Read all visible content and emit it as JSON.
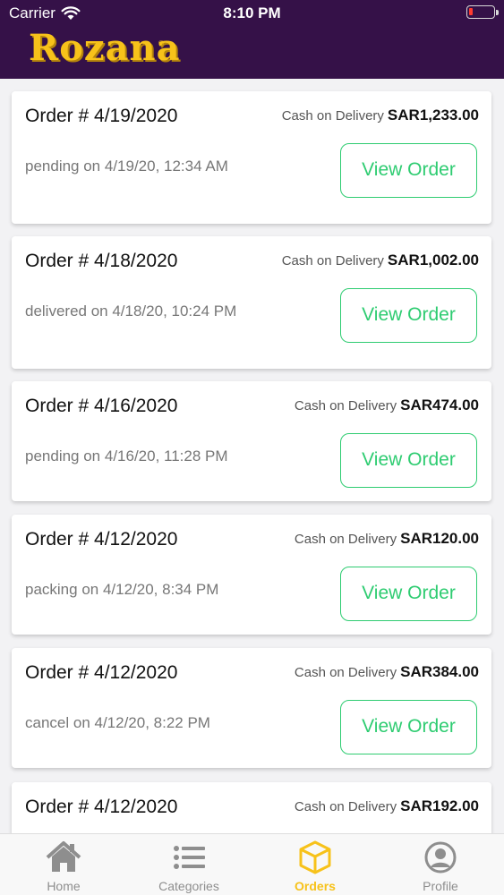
{
  "status_bar": {
    "carrier": "Carrier",
    "time": "8:10 PM"
  },
  "header": {
    "logo_text": "Rozana",
    "logo_mark": "®"
  },
  "orders": [
    {
      "title": "Order # 4/19/2020",
      "payment": "Cash on Delivery",
      "amount": "SAR1,233.00",
      "status": "pending on 4/19/20, 12:34 AM",
      "action": "View Order"
    },
    {
      "title": "Order # 4/18/2020",
      "payment": "Cash on Delivery",
      "amount": "SAR1,002.00",
      "status": "delivered on 4/18/20, 10:24 PM",
      "action": "View Order"
    },
    {
      "title": "Order # 4/16/2020",
      "payment": "Cash on Delivery",
      "amount": "SAR474.00",
      "status": "pending on 4/16/20, 11:28 PM",
      "action": "View Order"
    },
    {
      "title": "Order # 4/12/2020",
      "payment": "Cash on Delivery",
      "amount": "SAR120.00",
      "status": "packing on 4/12/20, 8:34 PM",
      "action": "View Order"
    },
    {
      "title": "Order # 4/12/2020",
      "payment": "Cash on Delivery",
      "amount": "SAR384.00",
      "status": "cancel on 4/12/20, 8:22 PM",
      "action": "View Order"
    },
    {
      "title": "Order # 4/12/2020",
      "payment": "Cash on Delivery",
      "amount": "SAR192.00",
      "status": "",
      "action": ""
    }
  ],
  "tabs": [
    {
      "label": "Home",
      "icon": "home-icon"
    },
    {
      "label": "Categories",
      "icon": "list-icon"
    },
    {
      "label": "Orders",
      "icon": "box-icon",
      "active": true
    },
    {
      "label": "Profile",
      "icon": "profile-icon"
    }
  ],
  "colors": {
    "header": "#351148",
    "brand": "#f7c21a",
    "action": "#2ecc71"
  }
}
